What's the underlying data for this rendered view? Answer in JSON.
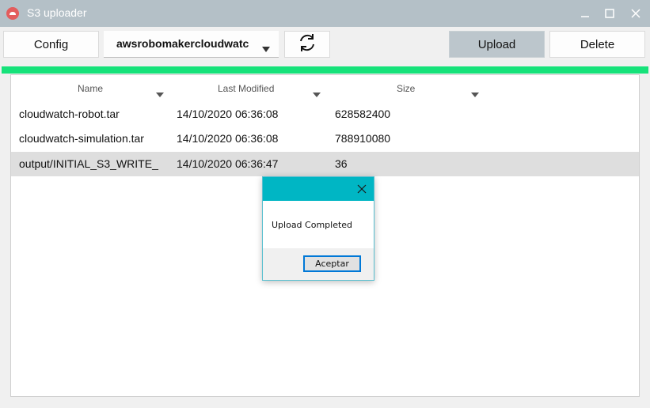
{
  "window": {
    "title": "S3 uploader",
    "accent_color": "#b4c0c7",
    "icons": [
      "app-icon",
      "minimize-icon",
      "maximize-icon",
      "close-icon"
    ]
  },
  "toolbar": {
    "config_label": "Config",
    "bucket_value": "awsrobomakercloudwatch",
    "refresh_icon": "refresh-icon",
    "upload_label": "Upload",
    "delete_label": "Delete"
  },
  "progress": {
    "value_percent": 100,
    "color": "#16e27a"
  },
  "table": {
    "columns": [
      "Name",
      "Last Modified",
      "Size"
    ],
    "rows": [
      {
        "name": "cloudwatch-robot.tar",
        "modified": "14/10/2020 06:36:08",
        "size": "628582400",
        "selected": false
      },
      {
        "name": "cloudwatch-simulation.tar",
        "modified": "14/10/2020 06:36:08",
        "size": "788910080",
        "selected": false
      },
      {
        "name": "output/INITIAL_S3_WRITE_",
        "modified": "14/10/2020 06:36:47",
        "size": "36",
        "selected": true
      }
    ]
  },
  "dialog": {
    "message": "Upload Completed",
    "ok_label": "Aceptar",
    "title_color": "#00b6c4"
  }
}
